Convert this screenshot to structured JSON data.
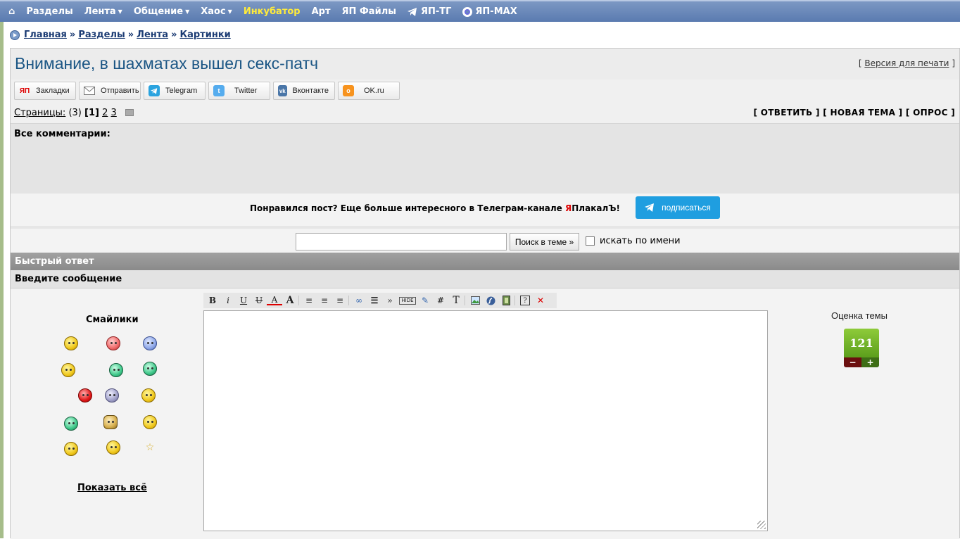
{
  "nav": {
    "home_icon": "home-icon",
    "items": [
      {
        "label": "Разделы"
      },
      {
        "label": "Лента"
      },
      {
        "label": "Общение"
      },
      {
        "label": "Хаос"
      },
      {
        "label": "Инкубатор"
      },
      {
        "label": "Арт"
      },
      {
        "label": "ЯП Файлы"
      },
      {
        "label": "ЯП-ТГ"
      },
      {
        "label": "ЯП-MAX"
      }
    ],
    "highlight_color": "#ffeb3b"
  },
  "breadcrumb": {
    "items": [
      "Главная",
      "Разделы",
      "Лента",
      "Картинки"
    ],
    "separator": "»"
  },
  "topic": {
    "title": "Внимание, в шахматах вышел секс-патч",
    "print_label": "Версия для печати",
    "bracket_open": "[",
    "bracket_close": "]"
  },
  "share": [
    {
      "label": "Закладки",
      "icon": "ЯП",
      "color": "#d00000"
    },
    {
      "label": "Отправить",
      "icon": "mail-icon",
      "color": "#888888"
    },
    {
      "label": "Telegram",
      "icon": "telegram-icon",
      "color": "#2aa3df"
    },
    {
      "label": "Twitter",
      "icon": "twitter-icon",
      "color": "#55acee"
    },
    {
      "label": "Вконтакте",
      "icon": "vk-icon",
      "color": "#4a76a8"
    },
    {
      "label": "OK.ru",
      "icon": "ok-icon",
      "color": "#f7931e"
    }
  ],
  "pagination": {
    "label": "Страницы:",
    "count": "(3)",
    "current": "[1]",
    "page2": "2",
    "page3": "3"
  },
  "actions": "[ ОТВЕТИТЬ ] [ НОВАЯ ТЕМА ] [ ОПРОС ]",
  "comments": {
    "label": "Все комментарии:"
  },
  "promo": {
    "text_before": "Понравился пост? Еще больше интересного в Телеграм-канале ",
    "brand_red": "Я",
    "brand_rest": "ПлакалЪ!",
    "button_label": "подписаться"
  },
  "search": {
    "input_value": "",
    "button_label": "Поиск в теме »",
    "by_name_label": "искать по имени"
  },
  "quick_reply": {
    "header": "Быстрый ответ",
    "enter_message": "Введите сообщение"
  },
  "smiles": {
    "title": "Смайлики",
    "show_all": "Показать всё"
  },
  "rating": {
    "label": "Оценка темы",
    "value": "121",
    "minus": "−",
    "plus": "+"
  }
}
